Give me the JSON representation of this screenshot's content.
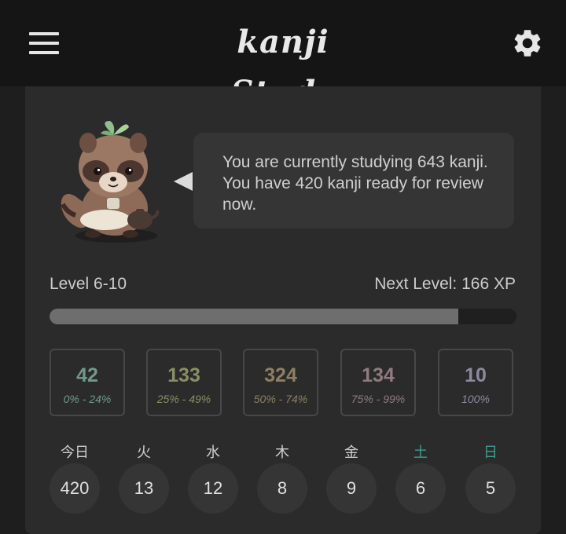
{
  "header": {
    "app_title": "kanji Study",
    "menu_icon": "hamburger-menu-icon",
    "settings_icon": "gear-icon"
  },
  "status": {
    "message": "You are currently studying 643 kanji. You have 420 kanji ready for review now."
  },
  "level": {
    "label": "Level 6-10",
    "next_level": "Next Level: 166 XP",
    "progress_fraction": 0.876
  },
  "srs": [
    {
      "count": "42",
      "range": "0% - 24%",
      "color": "#6f9a8a"
    },
    {
      "count": "133",
      "range": "25% - 49%",
      "color": "#8a8f63"
    },
    {
      "count": "324",
      "range": "50% - 74%",
      "color": "#8d8062"
    },
    {
      "count": "134",
      "range": "75% - 99%",
      "color": "#8f7b80"
    },
    {
      "count": "10",
      "range": "100%",
      "color": "#8c8a9f"
    }
  ],
  "forecast": [
    {
      "day": "今日",
      "count": "420",
      "color": "#cfcfcf"
    },
    {
      "day": "火",
      "count": "13",
      "color": "#cfcfcf"
    },
    {
      "day": "水",
      "count": "12",
      "color": "#cfcfcf"
    },
    {
      "day": "木",
      "count": "8",
      "color": "#cfcfcf"
    },
    {
      "day": "金",
      "count": "9",
      "color": "#cfcfcf"
    },
    {
      "day": "土",
      "count": "6",
      "color": "#3f9c8f"
    },
    {
      "day": "日",
      "count": "5",
      "color": "#3f9c8f"
    }
  ]
}
